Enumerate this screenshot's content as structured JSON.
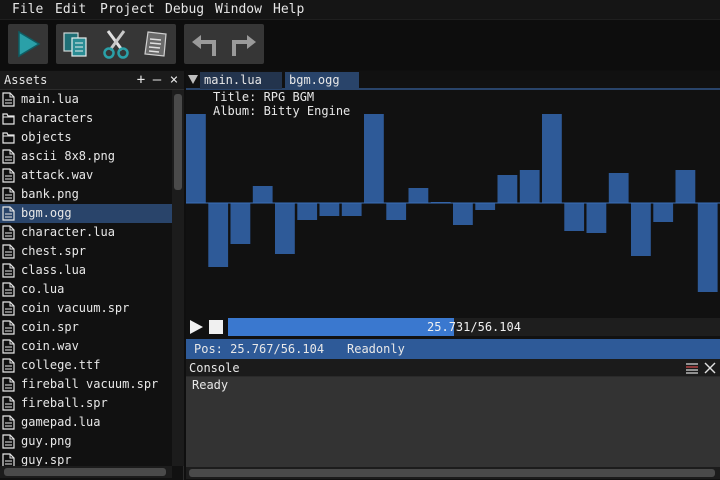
{
  "menu": [
    "File",
    "Edit",
    "Project",
    "Debug",
    "Window",
    "Help"
  ],
  "toolbar": {
    "buttons": [
      "run-icon",
      "copy-icon",
      "cut-icon",
      "paste-icon",
      "undo-icon",
      "redo-icon"
    ],
    "colors": {
      "run": "#2aa0a8",
      "group": "#363636"
    }
  },
  "assets": {
    "title": "Assets",
    "add_icon": "+",
    "minimize_icon": "—",
    "close_icon": "×",
    "items": [
      {
        "label": "main.lua",
        "type": "file"
      },
      {
        "label": "characters",
        "type": "folder"
      },
      {
        "label": "objects",
        "type": "folder"
      },
      {
        "label": "ascii 8x8.png",
        "type": "file"
      },
      {
        "label": "attack.wav",
        "type": "file"
      },
      {
        "label": "bank.png",
        "type": "file"
      },
      {
        "label": "bgm.ogg",
        "type": "file",
        "selected": true
      },
      {
        "label": "character.lua",
        "type": "file"
      },
      {
        "label": "chest.spr",
        "type": "file"
      },
      {
        "label": "class.lua",
        "type": "file"
      },
      {
        "label": "co.lua",
        "type": "file"
      },
      {
        "label": "coin vacuum.spr",
        "type": "file"
      },
      {
        "label": "coin.spr",
        "type": "file"
      },
      {
        "label": "coin.wav",
        "type": "file"
      },
      {
        "label": "college.ttf",
        "type": "file"
      },
      {
        "label": "fireball vacuum.spr",
        "type": "file"
      },
      {
        "label": "fireball.spr",
        "type": "file"
      },
      {
        "label": "gamepad.lua",
        "type": "file"
      },
      {
        "label": "guy.png",
        "type": "file"
      },
      {
        "label": "guy.spr",
        "type": "file"
      }
    ]
  },
  "editor": {
    "tabs": [
      "main.lua",
      "bgm.ogg"
    ],
    "active_tab": "bgm.ogg",
    "meta": {
      "title_line": "Title: RPG BGM",
      "album_line": "Album: Bitty Engine"
    },
    "waveform": {
      "bar_color": "#2e5a98",
      "baseline_color": "#3a6fb8",
      "amplitudes": [
        0.89,
        -0.64,
        -0.41,
        0.17,
        -0.51,
        -0.17,
        -0.13,
        -0.13,
        0.89,
        -0.17,
        0.15,
        0.01,
        -0.22,
        -0.07,
        0.28,
        0.33,
        0.89,
        -0.28,
        -0.3,
        0.3,
        -0.53,
        -0.19,
        0.33,
        -0.89
      ]
    },
    "transport": {
      "progress_text": "25.731/56.104",
      "progress_fraction": 0.4586,
      "play_icon": "play-icon",
      "stop_icon": "stop-icon",
      "fill_color": "#3a78cf"
    },
    "status": {
      "position": "Pos: 25.767/56.104",
      "mode": "Readonly"
    }
  },
  "console": {
    "title": "Console",
    "output": "Ready",
    "icons": [
      "clear-log-icon",
      "close-icon"
    ]
  }
}
